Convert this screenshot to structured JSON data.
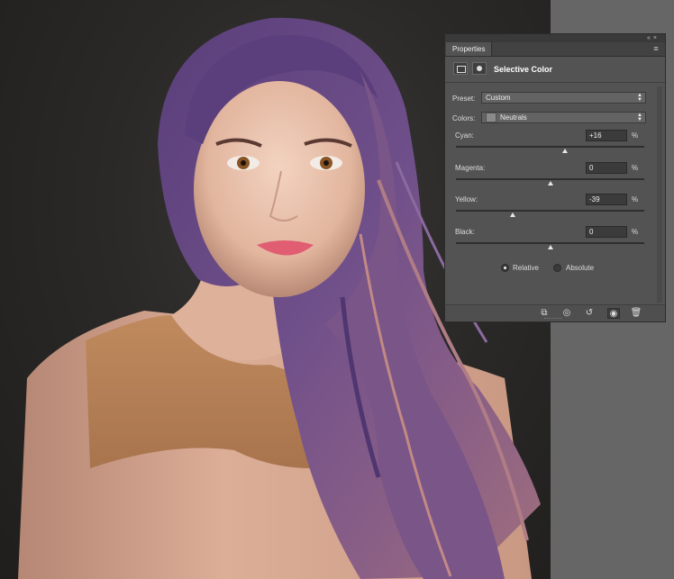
{
  "panel": {
    "tab_label": "Properties",
    "title": "Selective Color",
    "preset_label": "Preset:",
    "preset_value": "Custom",
    "colors_label": "Colors:",
    "colors_value": "Neutrals",
    "sliders": [
      {
        "label": "Cyan:",
        "value": "+16",
        "unit": "%",
        "level": 0.58
      },
      {
        "label": "Magenta:",
        "value": "0",
        "unit": "%",
        "level": 0.5
      },
      {
        "label": "Yellow:",
        "value": "-39",
        "unit": "%",
        "level": 0.3
      },
      {
        "label": "Black:",
        "value": "0",
        "unit": "%",
        "level": 0.5
      }
    ],
    "method": {
      "relative_label": "Relative",
      "absolute_label": "Absolute",
      "selected": "Relative"
    },
    "bottom_icons": [
      "clip-to-layer-icon",
      "view-previous-state-icon",
      "reset-icon",
      "visibility-icon",
      "trash-icon"
    ]
  },
  "colors": {
    "panel_bg": "#535353",
    "hair": "#6b4d86",
    "background": "#2a2928",
    "skin": "#e9c3ae",
    "blouse": "#d9a68f",
    "yoke": "#b98255"
  }
}
